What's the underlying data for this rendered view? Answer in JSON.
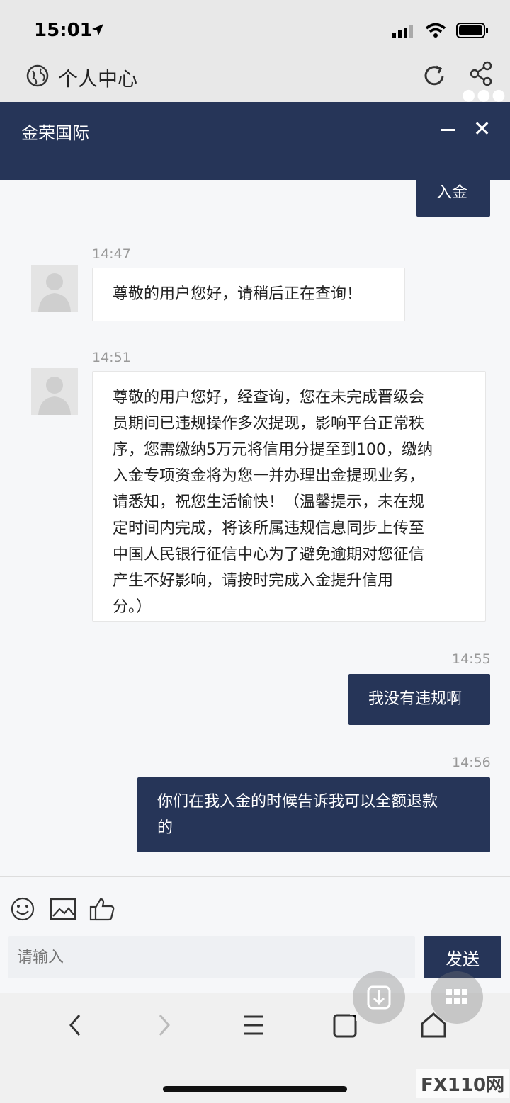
{
  "status_bar": {
    "time": "15:01"
  },
  "browser": {
    "title": "个人中心"
  },
  "app": {
    "title": "金荣国际"
  },
  "messages": [
    {
      "from": "user",
      "text": "入金"
    },
    {
      "from": "agent",
      "time": "14:47",
      "text": "尊敬的用户您好，请稍后正在查询！"
    },
    {
      "from": "agent",
      "time": "14:51",
      "lines": [
        "尊敬的用户您好，经查询，您在未完成晋级会",
        "员期间已违规操作多次提现，影响平台正常秩",
        "序，您需缴纳5万元将信用分提至到100，缴纳",
        "入金专项资金将为您一并办理出金提现业务，",
        "请悉知，祝您生活愉快！（温馨提示，未在规",
        "定时间内完成，将该所属违规信息同步上传至",
        "中国人民银行征信中心为了避免逾期对您征信",
        "产生不好影响，请按时完成入金提升信用",
        "分。）"
      ]
    },
    {
      "from": "user",
      "time": "14:55",
      "text": "我没有违规啊"
    },
    {
      "from": "user",
      "time": "14:56",
      "lines": [
        "你们在我入金的时候告诉我可以全额退款",
        "的"
      ]
    }
  ],
  "composer": {
    "placeholder": "请输入",
    "send_label": "发送"
  },
  "watermark": "FX110网",
  "colors": {
    "brand": "#263558",
    "background": "#f6f7f9"
  }
}
